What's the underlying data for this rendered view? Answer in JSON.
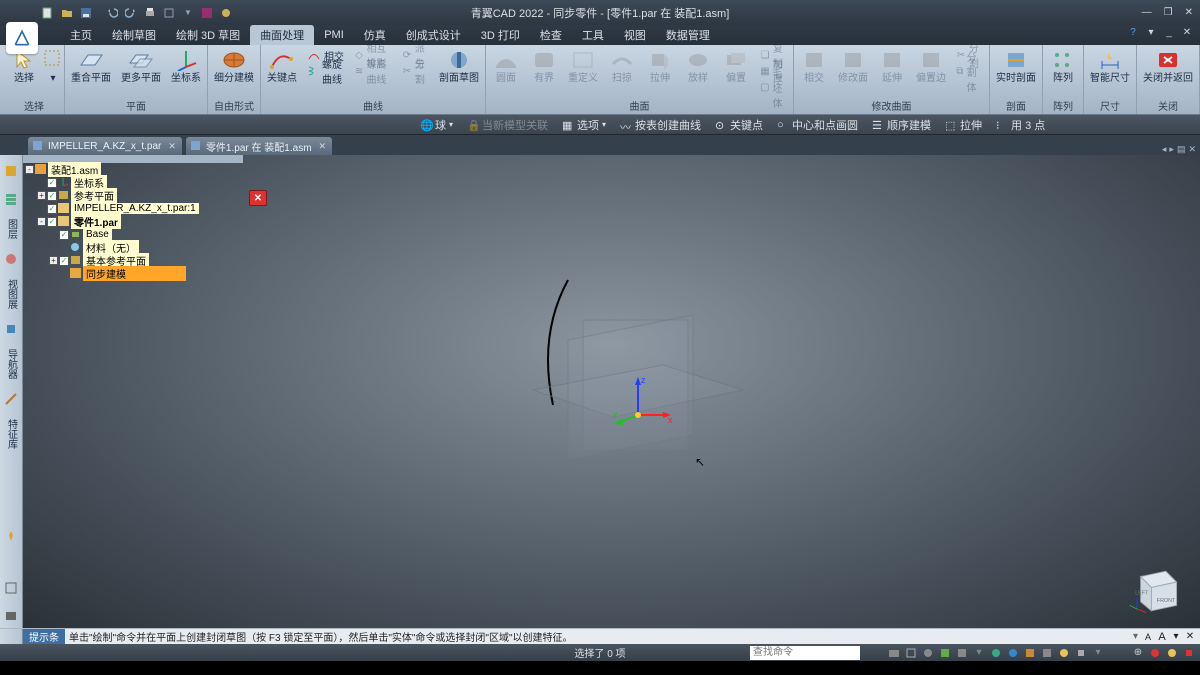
{
  "title": "青翼CAD 2022 - 同步零件 - [零件1.par 在 装配1.asm]",
  "titlebar_icons": [
    "new",
    "open",
    "save",
    "sep",
    "undo",
    "redo",
    "sep",
    "copy",
    "paste",
    "sep",
    "view1",
    "view2",
    "sep",
    "help"
  ],
  "menu": {
    "items": [
      "主页",
      "绘制草图",
      "绘制 3D 草图",
      "曲面处理",
      "PMI",
      "仿真",
      "创成式设计",
      "3D 打印",
      "检查",
      "工具",
      "视图",
      "数据管理"
    ],
    "active_index": 3
  },
  "ribbon": {
    "groups": [
      {
        "label": "选择",
        "items": [
          {
            "t": "big",
            "lbl": "选择",
            "ico": "cursor",
            "accent": "#d9a62e"
          },
          {
            "t": "big",
            "lbl": "",
            "ico": "dropdown",
            "dim": true
          }
        ]
      },
      {
        "label": "平面",
        "items": [
          {
            "t": "big",
            "lbl": "重合平面",
            "ico": "plane"
          },
          {
            "t": "big",
            "lbl": "更多平面",
            "ico": "plane2"
          },
          {
            "t": "big",
            "lbl": "坐标系",
            "ico": "axes"
          }
        ]
      },
      {
        "label": "自由形式",
        "items": [
          {
            "t": "big",
            "lbl": "细分建模",
            "ico": "subdiv"
          }
        ]
      },
      {
        "label": "曲线",
        "items": [
          {
            "t": "big",
            "lbl": "关键点",
            "ico": "keypts"
          },
          {
            "t": "col",
            "rows": [
              {
                "lbl": "相交",
                "ico": "intersect"
              },
              {
                "lbl": "螺旋曲线",
                "ico": "helix"
              },
              {
                "lbl": "",
                "ico": ""
              }
            ]
          },
          {
            "t": "col",
            "rows": [
              {
                "lbl": "相互投影",
                "ico": "proj",
                "dim": true
              },
              {
                "lbl": "等高曲线",
                "ico": "iso",
                "dim": true
              },
              {
                "lbl": "",
                "ico": ""
              }
            ]
          },
          {
            "t": "col",
            "rows": [
              {
                "lbl": "派生",
                "ico": "derive",
                "dim": true
              },
              {
                "lbl": "分割",
                "ico": "split",
                "dim": true
              },
              {
                "lbl": "",
                "ico": ""
              }
            ]
          },
          {
            "t": "big",
            "lbl": "剖面草图",
            "ico": "section"
          }
        ]
      },
      {
        "label": "曲面",
        "items": [
          {
            "t": "big",
            "lbl": "圆面",
            "ico": "s1",
            "dim": true
          },
          {
            "t": "big",
            "lbl": "有界",
            "ico": "s2",
            "dim": true
          },
          {
            "t": "big",
            "lbl": "重定义",
            "ico": "s3",
            "dim": true
          },
          {
            "t": "big",
            "lbl": "扫掠",
            "ico": "s4",
            "dim": true
          },
          {
            "t": "big",
            "lbl": "拉伸",
            "ico": "s5",
            "dim": true
          },
          {
            "t": "big",
            "lbl": "放样",
            "ico": "s6",
            "dim": true
          },
          {
            "t": "big",
            "lbl": "偏置",
            "ico": "s7",
            "dim": true
          },
          {
            "t": "col",
            "rows": [
              {
                "lbl": "复制",
                "ico": "cp",
                "dim": true
              },
              {
                "lbl": "加厚",
                "ico": "tk",
                "dim": true
              },
              {
                "lbl": "毛坯体",
                "ico": "bk",
                "dim": true
              }
            ]
          }
        ]
      },
      {
        "label": "修改曲面",
        "items": [
          {
            "t": "big",
            "lbl": "相交",
            "ico": "m1",
            "dim": true
          },
          {
            "t": "big",
            "lbl": "修改面",
            "ico": "m2",
            "dim": true
          },
          {
            "t": "big",
            "lbl": "延伸",
            "ico": "m3",
            "dim": true
          },
          {
            "t": "big",
            "lbl": "偏置边",
            "ico": "m4",
            "dim": true
          },
          {
            "t": "col",
            "rows": [
              {
                "lbl": "分割",
                "ico": "sp",
                "dim": true
              },
              {
                "lbl": "分割体",
                "ico": "sb",
                "dim": true
              },
              {
                "lbl": "",
                "ico": ""
              }
            ]
          }
        ]
      },
      {
        "label": "剖面",
        "items": [
          {
            "t": "big",
            "lbl": "实时剖面",
            "ico": "livesec"
          }
        ]
      },
      {
        "label": "阵列",
        "items": [
          {
            "t": "big",
            "lbl": "阵列",
            "ico": "pattern"
          }
        ]
      },
      {
        "label": "尺寸",
        "items": [
          {
            "t": "big",
            "lbl": "智能尺寸",
            "ico": "dim"
          }
        ]
      },
      {
        "label": "关闭",
        "items": [
          {
            "t": "big",
            "lbl": "关闭并返回",
            "ico": "close",
            "accent": "#d9302e"
          }
        ]
      }
    ]
  },
  "optbar": [
    {
      "ico": "globe",
      "lbl": "球"
    },
    {
      "ico": "lock",
      "lbl": "当新模型关联",
      "dim": true
    },
    {
      "ico": "opts",
      "lbl": "选项"
    },
    {
      "ico": "curve",
      "lbl": "按表创建曲线"
    },
    {
      "ico": "key",
      "lbl": "关键点"
    },
    {
      "ico": "circ",
      "lbl": "中心和点画圆"
    },
    {
      "ico": "seq",
      "lbl": "顺序建模"
    },
    {
      "ico": "ext",
      "lbl": "拉伸"
    },
    {
      "ico": "pts",
      "lbl": "用 3 点"
    }
  ],
  "doctabs": [
    {
      "label": "IMPELLER_A.KZ_x_t.par",
      "ico": "part"
    },
    {
      "label": "零件1.par 在 装配1.asm",
      "ico": "part"
    }
  ],
  "sidebar": [
    "home",
    "layers",
    "图层",
    "paint",
    "视图展",
    "导航器",
    "meas",
    "align",
    "wave",
    "sep",
    "pin",
    "sep",
    "sep",
    "box",
    "film"
  ],
  "tree": [
    {
      "ind": 0,
      "exp": "-",
      "chk": "",
      "ico": "asm",
      "txt": "装配1.asm",
      "bold": false
    },
    {
      "ind": 1,
      "exp": "",
      "chk": "✓",
      "ico": "csys",
      "txt": "坐标系",
      "bold": false
    },
    {
      "ind": 1,
      "exp": "+",
      "chk": "✓",
      "ico": "ref",
      "txt": "参考平面",
      "bold": false
    },
    {
      "ind": 1,
      "exp": "",
      "chk": "✓",
      "ico": "part",
      "txt": "IMPELLER_A.KZ_x_t.par:1",
      "bold": false
    },
    {
      "ind": 1,
      "exp": "-",
      "chk": "✓",
      "ico": "part",
      "txt": "零件1.par",
      "bold": true
    },
    {
      "ind": 2,
      "exp": "",
      "chk": "✓",
      "ico": "base",
      "txt": "Base",
      "bold": false
    },
    {
      "ind": 2,
      "exp": "",
      "chk": "",
      "ico": "mat",
      "txt": "材料（无）",
      "bold": false
    },
    {
      "ind": 2,
      "exp": "+",
      "chk": "✓",
      "ico": "ref",
      "txt": "基本参考平面",
      "bold": false
    },
    {
      "ind": 2,
      "exp": "",
      "chk": "",
      "ico": "sync",
      "txt": "同步建模",
      "sel": true
    }
  ],
  "triad": {
    "x": "x",
    "y": "y",
    "z": "z"
  },
  "viewcube": {
    "left": "LEFT",
    "front": "FRONT"
  },
  "prompt": {
    "tag": "提示条",
    "msg": "单击\"绘制\"命令并在平面上创建封闭草图（按 F3 锁定至平面），然后单击\"实体\"命令或选择封闭\"区域\"以创建特征。"
  },
  "status": {
    "center": "选择了 0 项",
    "cmd_placeholder": "查找命令"
  }
}
